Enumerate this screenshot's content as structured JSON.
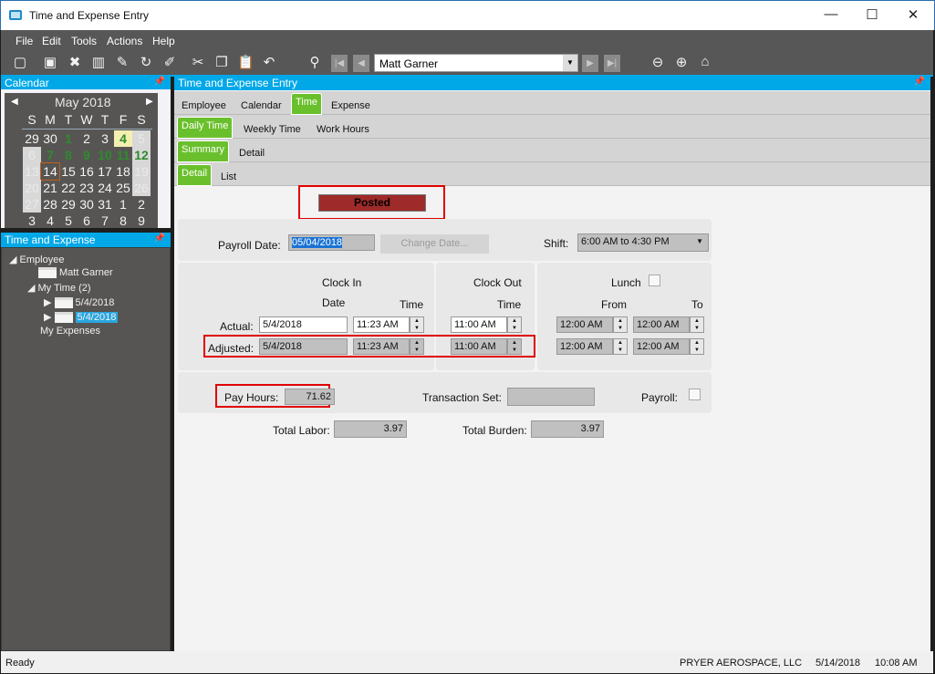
{
  "window": {
    "title": "Time and Expense Entry",
    "minimize": "—",
    "maximize": "☐",
    "close": "✕"
  },
  "menu": [
    "File",
    "Edit",
    "Tools",
    "Actions",
    "Help"
  ],
  "toolbar": {
    "employee": "Matt Garner"
  },
  "calendar": {
    "header": "Calendar",
    "month": "May 2018",
    "weekdays": [
      "S",
      "M",
      "T",
      "W",
      "T",
      "F",
      "S"
    ],
    "weeks": [
      [
        {
          "d": "29"
        },
        {
          "d": "30"
        },
        {
          "d": "1",
          "c": "g"
        },
        {
          "d": "2"
        },
        {
          "d": "3"
        },
        {
          "d": "4",
          "c": "sel"
        },
        {
          "d": "5",
          "c": "we"
        }
      ],
      [
        {
          "d": "6",
          "c": "we"
        },
        {
          "d": "7",
          "c": "g"
        },
        {
          "d": "8",
          "c": "g"
        },
        {
          "d": "9",
          "c": "g"
        },
        {
          "d": "10",
          "c": "g"
        },
        {
          "d": "11",
          "c": "g"
        },
        {
          "d": "12",
          "c": "weg"
        }
      ],
      [
        {
          "d": "13",
          "c": "we"
        },
        {
          "d": "14",
          "c": "today"
        },
        {
          "d": "15"
        },
        {
          "d": "16"
        },
        {
          "d": "17"
        },
        {
          "d": "18"
        },
        {
          "d": "19",
          "c": "we"
        }
      ],
      [
        {
          "d": "20",
          "c": "we"
        },
        {
          "d": "21"
        },
        {
          "d": "22"
        },
        {
          "d": "23"
        },
        {
          "d": "24"
        },
        {
          "d": "25"
        },
        {
          "d": "26",
          "c": "we"
        }
      ],
      [
        {
          "d": "27",
          "c": "we"
        },
        {
          "d": "28"
        },
        {
          "d": "29"
        },
        {
          "d": "30"
        },
        {
          "d": "31"
        },
        {
          "d": "1"
        },
        {
          "d": "2"
        }
      ],
      [
        {
          "d": "3"
        },
        {
          "d": "4"
        },
        {
          "d": "5"
        },
        {
          "d": "6"
        },
        {
          "d": "7"
        },
        {
          "d": "8"
        },
        {
          "d": "9"
        }
      ]
    ]
  },
  "tree": {
    "header": "Time and Expense",
    "employee": "Employee",
    "name": "Matt Garner",
    "mytime": "My Time (2)",
    "entry1": "5/4/2018",
    "entry2": "5/4/2018",
    "expenses": "My Expenses"
  },
  "main": {
    "header": "Time and Expense Entry",
    "tabs1": [
      "Employee",
      "Calendar",
      "Time",
      "Expense"
    ],
    "tabs2": [
      "Daily Time",
      "Weekly Time",
      "Work Hours"
    ],
    "tabs3": [
      "Summary",
      "Detail"
    ],
    "tabs4": [
      "Detail",
      "List"
    ],
    "status": "Posted",
    "status_color": "#9e2a2a",
    "payroll_date_label": "Payroll Date:",
    "payroll_date": "05/04/2018",
    "change_date": "Change Date...",
    "shift_label": "Shift:",
    "shift": "6:00 AM to 4:30 PM",
    "clock_in": "Clock In",
    "clock_out": "Clock Out",
    "date": "Date",
    "time": "Time",
    "lunch": "Lunch",
    "from": "From",
    "to": "To",
    "actual_label": "Actual:",
    "actual_date": "5/4/2018",
    "actual_in": "11:23 AM",
    "actual_out": "11:00 AM",
    "actual_lfrom": "12:00 AM",
    "actual_lto": "12:00 AM",
    "adjusted_label": "Adjusted:",
    "adj_date": "5/4/2018",
    "adj_in": "11:23 AM",
    "adj_out": "11:00 AM",
    "adj_lfrom": "12:00 AM",
    "adj_lto": "12:00 AM",
    "pay_hours_label": "Pay Hours:",
    "pay_hours": "71.62",
    "transaction_set_label": "Transaction Set:",
    "transaction_set": "",
    "payroll_label": "Payroll:",
    "total_labor_label": "Total Labor:",
    "total_labor": "3.97",
    "total_burden_label": "Total Burden:",
    "total_burden": "3.97"
  },
  "statusbar": {
    "state": "Ready",
    "company": "PRYER AEROSPACE, LLC",
    "date": "5/14/2018",
    "time": "10:08 AM"
  }
}
